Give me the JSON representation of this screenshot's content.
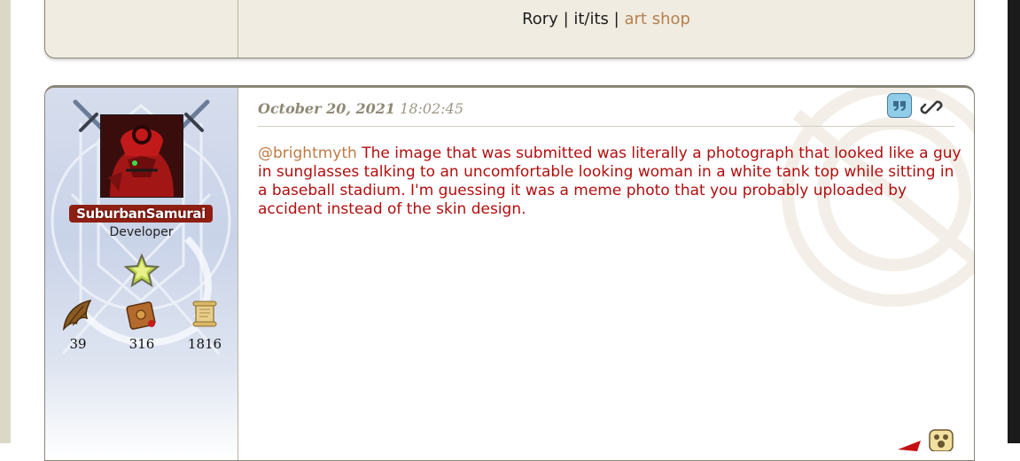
{
  "signature": {
    "name": "Rory",
    "pronouns": "it/its",
    "separator": "|",
    "link": "art shop"
  },
  "post": {
    "date": "October 20, 2021",
    "time": "18:02:45",
    "mention": "@brightmyth",
    "message": " The image that was submitted was literally a photograph that looked like a guy in sunglasses talking to an uncomfortable looking woman in a white tank top while sitting in a baseball stadium. I'm guessing it was a meme photo that you probably uploaded by accident instead of the skin design."
  },
  "author": {
    "username": "SuburbanSamurai",
    "title": "Developer",
    "stats": [
      {
        "icon": "dragon-wing-icon",
        "value": "39"
      },
      {
        "icon": "treasure-book-icon",
        "value": "316"
      },
      {
        "icon": "scroll-icon",
        "value": "1816"
      }
    ]
  },
  "colors": {
    "message_text": "#b10e0e",
    "mention": "#c07a45",
    "link": "#b5804f",
    "username_bg": "#8f1f12",
    "quote_button": "#8fcde8"
  }
}
